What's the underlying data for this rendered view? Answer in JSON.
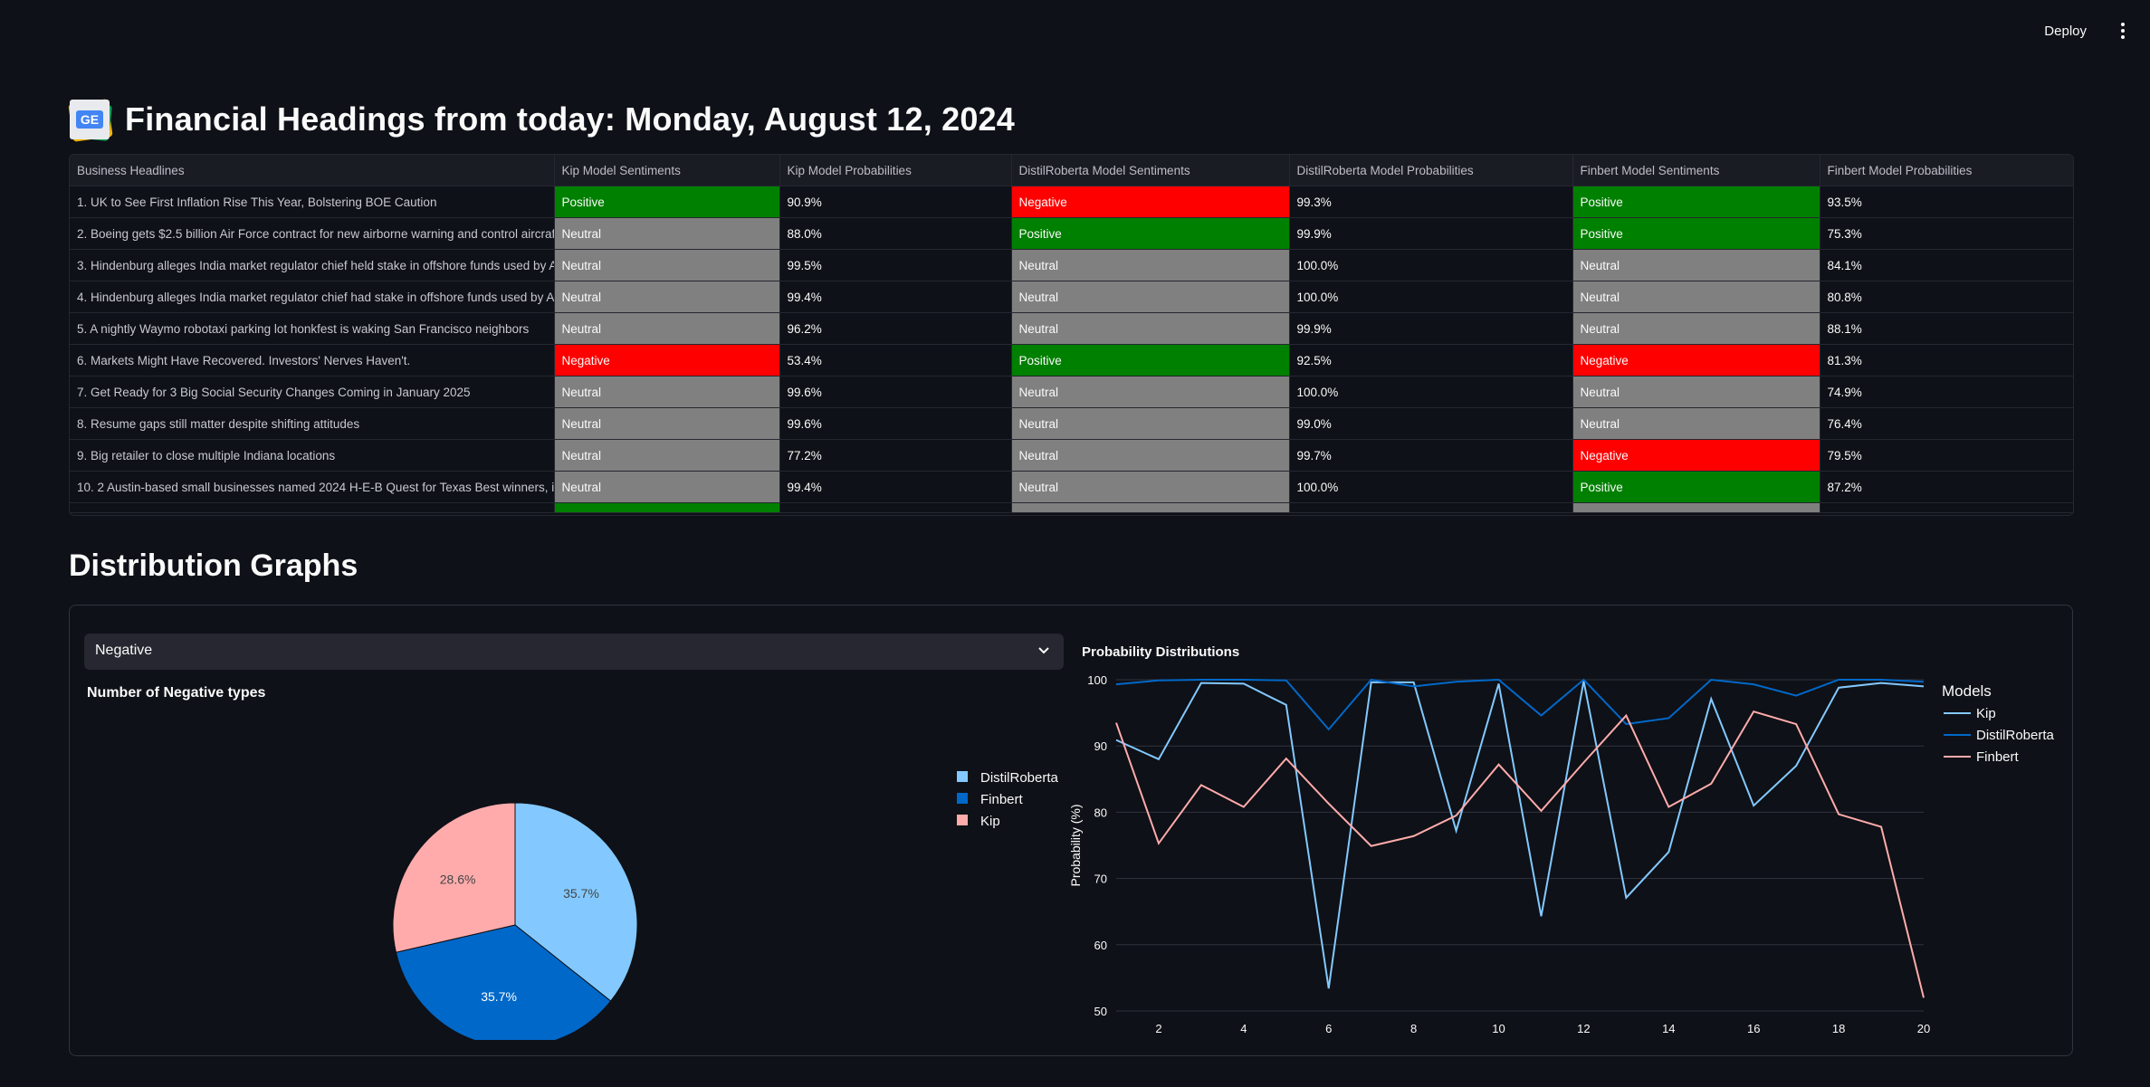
{
  "app": {
    "deploy_label": "Deploy",
    "title": "Financial Headings from today: Monday, August 12, 2024",
    "logo_text": "GE"
  },
  "table": {
    "columns": [
      "Business Headlines",
      "Kip Model Sentiments",
      "Kip Model Probabilities",
      "DistilRoberta Model Sentiments",
      "DistilRoberta Model Probabilities",
      "Finbert Model Sentiments",
      "Finbert Model Probabilities"
    ],
    "rows": [
      [
        "1. UK to See First Inflation Rise This Year, Bolstering BOE Caution",
        "Positive",
        "90.9%",
        "Negative",
        "99.3%",
        "Positive",
        "93.5%"
      ],
      [
        "2. Boeing gets $2.5 billion Air Force contract for new airborne warning and control aircraft",
        "Neutral",
        "88.0%",
        "Positive",
        "99.9%",
        "Positive",
        "75.3%"
      ],
      [
        "3. Hindenburg alleges India market regulator chief held stake in offshore funds used by Adani",
        "Neutral",
        "99.5%",
        "Neutral",
        "100.0%",
        "Neutral",
        "84.1%"
      ],
      [
        "4. Hindenburg alleges India market regulator chief had stake in offshore funds used by Adani",
        "Neutral",
        "99.4%",
        "Neutral",
        "100.0%",
        "Neutral",
        "80.8%"
      ],
      [
        "5. A nightly Waymo robotaxi parking lot honkfest is waking San Francisco neighbors",
        "Neutral",
        "96.2%",
        "Neutral",
        "99.9%",
        "Neutral",
        "88.1%"
      ],
      [
        "6. Markets Might Have Recovered. Investors' Nerves Haven't.",
        "Negative",
        "53.4%",
        "Positive",
        "92.5%",
        "Negative",
        "81.3%"
      ],
      [
        "7. Get Ready for 3 Big Social Security Changes Coming in January 2025",
        "Neutral",
        "99.6%",
        "Neutral",
        "100.0%",
        "Neutral",
        "74.9%"
      ],
      [
        "8. Resume gaps still matter despite shifting attitudes",
        "Neutral",
        "99.6%",
        "Neutral",
        "99.0%",
        "Neutral",
        "76.4%"
      ],
      [
        "9. Big retailer to close multiple Indiana locations",
        "Neutral",
        "77.2%",
        "Neutral",
        "99.7%",
        "Negative",
        "79.5%"
      ],
      [
        "10. 2 Austin-based small businesses named 2024 H-E-B Quest for Texas Best winners, including",
        "Neutral",
        "99.4%",
        "Neutral",
        "100.0%",
        "Positive",
        "87.2%"
      ]
    ],
    "partial_row_sentiments": [
      "Positive",
      "Neutral",
      "Neutral"
    ]
  },
  "section": {
    "title": "Distribution Graphs"
  },
  "select": {
    "value": "Negative"
  },
  "colors": {
    "positive": "#008000",
    "neutral": "#808080",
    "negative": "#ff0000",
    "kip": "#83c9ff",
    "distilroberta": "#0068c9",
    "finbert": "#ffabab"
  },
  "chart_data": [
    {
      "type": "pie",
      "title": "Number of Negative types",
      "labels": [
        "DistilRoberta",
        "Finbert",
        "Kip"
      ],
      "values": [
        35.7,
        35.7,
        28.6
      ],
      "value_labels": [
        "35.7%",
        "35.7%",
        "28.6%"
      ],
      "legend": "top-right"
    },
    {
      "type": "line",
      "title": "Probability Distributions",
      "xlabel": "Number of Headlines",
      "ylabel": "Probability (%)",
      "legend_title": "Models",
      "legend": "top-right",
      "x": [
        1,
        2,
        3,
        4,
        5,
        6,
        7,
        8,
        9,
        10,
        11,
        12,
        13,
        14,
        15,
        16,
        17,
        18,
        19,
        20
      ],
      "xlim": [
        1,
        20
      ],
      "ylim": [
        50,
        100
      ],
      "xticks": [
        2,
        4,
        6,
        8,
        10,
        12,
        14,
        16,
        18,
        20
      ],
      "yticks": [
        50,
        60,
        70,
        80,
        90,
        100
      ],
      "grid": true,
      "series": [
        {
          "name": "Kip",
          "values": [
            90.9,
            88.0,
            99.5,
            99.4,
            96.2,
            53.4,
            99.6,
            99.6,
            77.2,
            99.4,
            64.3,
            99.8,
            67.1,
            74.0,
            97.1,
            81.0,
            87.0,
            98.8,
            99.5,
            99.0
          ]
        },
        {
          "name": "DistilRoberta",
          "values": [
            99.3,
            99.9,
            100.0,
            100.0,
            99.9,
            92.5,
            100.0,
            99.0,
            99.7,
            100.0,
            94.6,
            100.0,
            93.3,
            94.2,
            100.0,
            99.3,
            97.6,
            100.0,
            100.0,
            99.7
          ]
        },
        {
          "name": "Finbert",
          "values": [
            93.5,
            75.3,
            84.1,
            80.8,
            88.1,
            81.3,
            74.9,
            76.4,
            79.5,
            87.2,
            80.2,
            87.5,
            94.6,
            80.8,
            84.3,
            95.2,
            93.3,
            79.7,
            77.8,
            52.0
          ]
        }
      ]
    }
  ]
}
